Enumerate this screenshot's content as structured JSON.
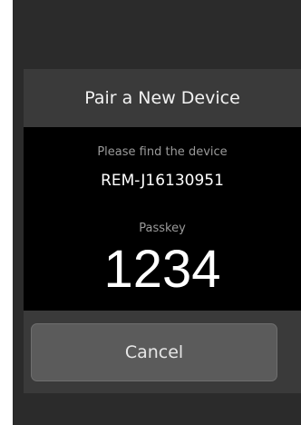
{
  "dialog": {
    "title": "Pair a New Device",
    "instruction": "Please find the device",
    "device_name": "REM-J16130951",
    "passkey_label": "Passkey",
    "passkey_value": "1234",
    "cancel_label": "Cancel"
  },
  "colors": {
    "phone_background": "#2b2b2b",
    "dialog_background": "#3a3a3a",
    "body_background": "#000000",
    "button_background": "#5b5b5b"
  }
}
